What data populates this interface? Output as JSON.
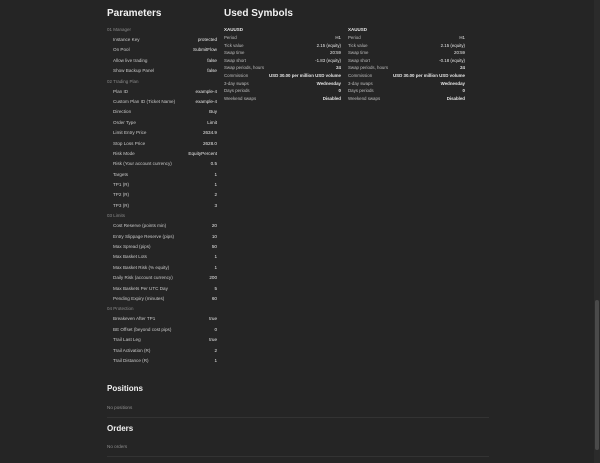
{
  "parameters": {
    "title": "Parameters",
    "groups": [
      {
        "title": "01 Manager",
        "rows": [
          {
            "key": "Instance Key",
            "value": "protected"
          },
          {
            "key": "On Pool",
            "value": "SubmitFlow"
          },
          {
            "key": "Allow live trading",
            "value": "false"
          },
          {
            "key": "Show Backup Panel",
            "value": "false"
          }
        ]
      },
      {
        "title": "02 Trading Plan",
        "rows": [
          {
            "key": "Plan ID",
            "value": "example-4"
          },
          {
            "key": "Custom Plan ID (Ticket Name)",
            "value": "example-4"
          },
          {
            "key": "Direction",
            "value": "Buy"
          },
          {
            "key": "Order Type",
            "value": "Limit"
          },
          {
            "key": "Limit Entry Price",
            "value": "2634.9"
          },
          {
            "key": "Stop Loss Price",
            "value": "2628.0"
          },
          {
            "key": "Risk Mode",
            "value": "EquityPercent"
          },
          {
            "key": "Risk (Your account currency)",
            "value": "0.5"
          },
          {
            "key": "Targets",
            "value": "1"
          },
          {
            "key": "TP1 (R)",
            "value": "1"
          },
          {
            "key": "TP2 (R)",
            "value": "2"
          },
          {
            "key": "TP3 (R)",
            "value": "3"
          }
        ]
      },
      {
        "title": "03 Limits",
        "rows": [
          {
            "key": "Cost Reserve (points min)",
            "value": "20"
          },
          {
            "key": "Entry Slippage Reserve (pips)",
            "value": "10"
          },
          {
            "key": "Max Spread (pips)",
            "value": "50"
          },
          {
            "key": "Max Basket Lots",
            "value": "1"
          },
          {
            "key": "Max Basket Risk (% equity)",
            "value": "1"
          },
          {
            "key": "Daily Risk (account currency)",
            "value": "200"
          },
          {
            "key": "Max Baskets Per UTC Day",
            "value": "5"
          },
          {
            "key": "Pending Expiry (minutes)",
            "value": "60"
          }
        ]
      },
      {
        "title": "04 Protection",
        "rows": [
          {
            "key": "Breakeven After TP1",
            "value": "true"
          },
          {
            "key": "BE Offset (beyond cost pips)",
            "value": "0"
          },
          {
            "key": "Trail Last Leg",
            "value": "true"
          },
          {
            "key": "Trail Activation (R)",
            "value": "2"
          },
          {
            "key": "Trail Distance (R)",
            "value": "1"
          }
        ]
      }
    ]
  },
  "symbols": {
    "title": "Used Symbols",
    "columns": [
      {
        "name": "XAUUSD",
        "rows": [
          {
            "key": "Period",
            "value": "H1"
          },
          {
            "key": "Tick value",
            "value": "2.15 (equity)"
          },
          {
            "key": "Swap time",
            "value": "20:59"
          },
          {
            "key": "Swap short",
            "value": "-1.83 (equity)"
          },
          {
            "key": "Swap periods, hours",
            "value": "24"
          },
          {
            "key": "Commission",
            "value": "USD 30.00 per million USD volume"
          },
          {
            "key": "3-day swaps",
            "value": "Wednesday"
          },
          {
            "key": "Days periods",
            "value": "0"
          },
          {
            "key": "Weekend swaps",
            "value": "Disabled"
          }
        ]
      },
      {
        "name": "XAUUSD",
        "rows": [
          {
            "key": "Period",
            "value": "H1"
          },
          {
            "key": "Tick value",
            "value": "2.15 (equity)"
          },
          {
            "key": "Swap time",
            "value": "20:59"
          },
          {
            "key": "Swap short",
            "value": "-0.18 (equity)"
          },
          {
            "key": "Swap periods, hours",
            "value": "24"
          },
          {
            "key": "Commission",
            "value": "USD 30.00 per million USD volume"
          },
          {
            "key": "3-day swaps",
            "value": "Wednesday"
          },
          {
            "key": "Days periods",
            "value": "0"
          },
          {
            "key": "Weekend swaps",
            "value": "Disabled"
          }
        ]
      }
    ]
  },
  "positions": {
    "title": "Positions",
    "empty": "No positions"
  },
  "orders": {
    "title": "Orders",
    "empty": "No orders"
  }
}
